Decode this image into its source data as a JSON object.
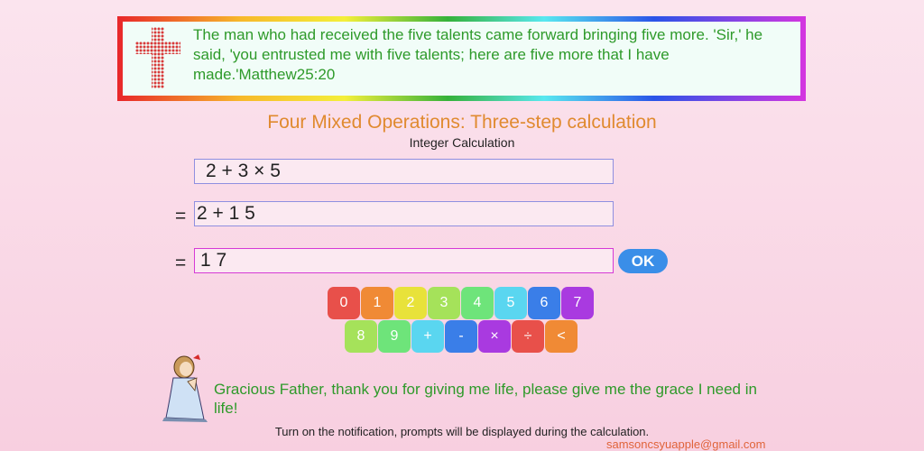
{
  "verse": {
    "text": "The man who had received the five talents came forward bringing five more. 'Sir,' he said, 'you entrusted me with five talents; here are five more that I have made.'Matthew25:20"
  },
  "title": "Four Mixed Operations: Three-step calculation",
  "subtitle": "Integer Calculation",
  "steps": {
    "step1": "2 + 3 × 5",
    "step2": "2 + 1 5",
    "step3": "1 7",
    "eq": "="
  },
  "ok_label": "OK",
  "keypad": {
    "row1": [
      "0",
      "1",
      "2",
      "3",
      "4",
      "5",
      "6",
      "7"
    ],
    "row2": [
      "8",
      "9",
      "+",
      "-",
      "×",
      "÷",
      "<"
    ]
  },
  "prayer": "Gracious Father, thank you for giving me life, please give me the grace I need in life!",
  "notice": "Turn on the notification, prompts will be displayed during the calculation.",
  "email": "samsoncsyuapple@gmail.com",
  "colors": {
    "key0": "#e8504a",
    "key1": "#f08a35",
    "key2": "#e8e23a",
    "key3": "#a5e25a",
    "key4": "#6ee47a",
    "key5": "#5ad6f0",
    "key6": "#3a7ee8",
    "key7": "#a93ae0",
    "key8": "#a5e25a",
    "key9": "#6ee47a",
    "keyPlus": "#5ad6f0",
    "keyMinus": "#3a7ee8",
    "keyTimes": "#a93ae0",
    "keyDiv": "#e8504a",
    "keyBack": "#f08a35"
  }
}
